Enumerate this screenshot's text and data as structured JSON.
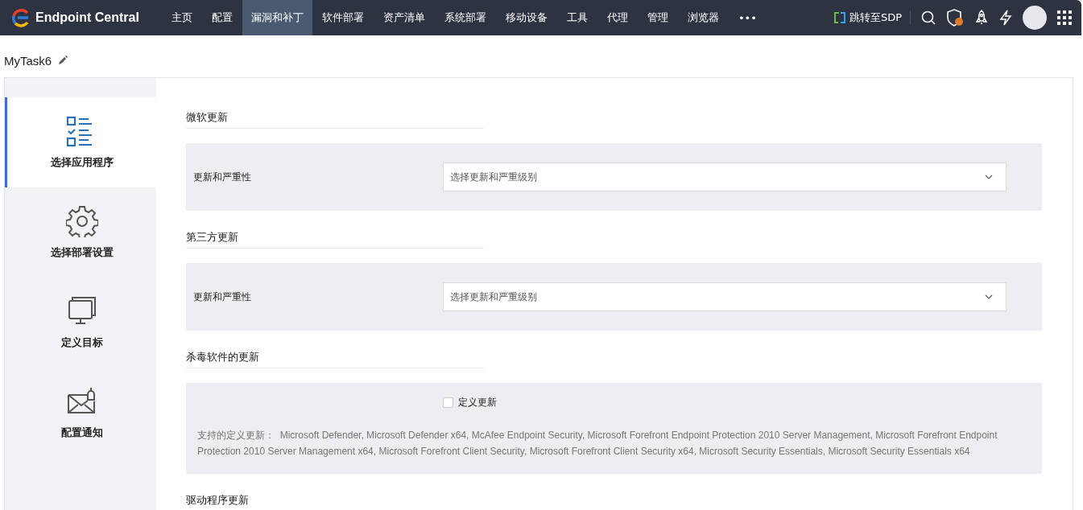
{
  "brand": {
    "name": "Endpoint Central"
  },
  "nav": [
    {
      "label": "主页",
      "selected": false
    },
    {
      "label": "配置",
      "selected": false
    },
    {
      "label": "漏洞和补丁",
      "selected": true
    },
    {
      "label": "软件部署",
      "selected": false
    },
    {
      "label": "资产清单",
      "selected": false
    },
    {
      "label": "系统部署",
      "selected": false
    },
    {
      "label": "移动设备",
      "selected": false
    },
    {
      "label": "工具",
      "selected": false
    },
    {
      "label": "代理",
      "selected": false
    },
    {
      "label": "管理",
      "selected": false
    },
    {
      "label": "浏览器",
      "selected": false
    },
    {
      "label": "•••",
      "selected": false
    }
  ],
  "sdp_link": "跳转至SDP",
  "task_title": "MyTask6",
  "steps": [
    {
      "label": "选择应用程序",
      "selected": true
    },
    {
      "label": "选择部署设置",
      "selected": false
    },
    {
      "label": "定义目标",
      "selected": false
    },
    {
      "label": "配置通知",
      "selected": false
    }
  ],
  "sections": [
    {
      "heading": "微软更新",
      "kind": "select",
      "label": "更新和严重性",
      "placeholder": "选择更新和严重级别"
    },
    {
      "heading": "第三方更新",
      "kind": "select",
      "label": "更新和严重性",
      "placeholder": "选择更新和严重级别"
    },
    {
      "heading": "杀毒软件的更新",
      "kind": "checkbox",
      "checkbox_label": "定义更新",
      "checked": false,
      "note_label": "支持的定义更新：",
      "note": "Microsoft Defender, Microsoft Defender x64, McAfee Endpoint Security, Microsoft Forefront Endpoint Protection 2010 Server Management, Microsoft Forefront Endpoint Protection 2010 Server Management x64, Microsoft Forefront Client Security, Microsoft Forefront Client Security x64, Microsoft Security Essentials, Microsoft Security Essentials x64"
    },
    {
      "heading": "驱动程序更新",
      "kind": "cut"
    }
  ]
}
